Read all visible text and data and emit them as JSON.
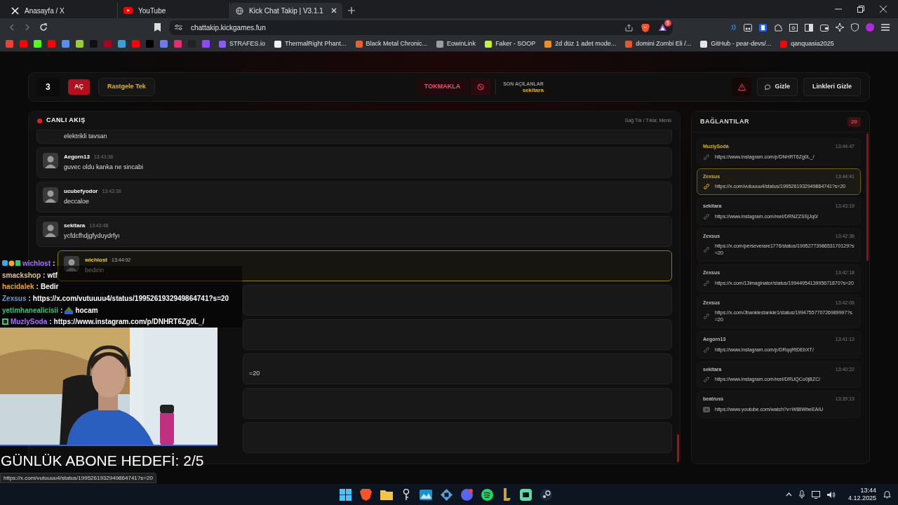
{
  "browser": {
    "tabs": [
      {
        "title": "Anasayfa / X",
        "kind": "x",
        "selected": false
      },
      {
        "title": "YouTube",
        "kind": "youtube",
        "selected": false
      },
      {
        "title": "Kick Chat Takip | V3.1.1",
        "kind": "globe",
        "selected": true
      }
    ],
    "url": "chattakip.kickgames.fun",
    "alert_badge": "5",
    "icon_bookmarks": [
      {
        "color": "#ea4335"
      },
      {
        "color": "#ff0000"
      },
      {
        "color": "#53fc18"
      },
      {
        "color": "#ff0000"
      },
      {
        "color": "#5b8def"
      },
      {
        "color": "#9acd32"
      },
      {
        "color": "#111111"
      },
      {
        "color": "#b00020"
      },
      {
        "color": "#3aa0d8"
      },
      {
        "color": "#ff0000"
      },
      {
        "color": "#000000"
      },
      {
        "color": "#6c7bf0"
      },
      {
        "color": "#e1306c"
      },
      {
        "color": "#222222"
      },
      {
        "color": "#9146ff"
      }
    ],
    "bookmarks": [
      {
        "label": "STRAFES.io",
        "color": "#8b5cf6"
      },
      {
        "label": "ThermalRight Phant...",
        "color": "#f3f3f3"
      },
      {
        "label": "Black Metal Chronic...",
        "color": "#e8622c"
      },
      {
        "label": "EowinLink",
        "color": "#9aa0a6"
      },
      {
        "label": "Faker - SOOP",
        "color": "#c7f23a"
      },
      {
        "label": "2d düz 1 adet mode...",
        "color": "#f28c28"
      },
      {
        "label": "domini Zombi Eli /...",
        "color": "#e05a2b"
      },
      {
        "label": "GitHub - pear-devs/...",
        "color": "#e6e6e6"
      },
      {
        "label": "qanquasia2025",
        "color": "#ff0000"
      }
    ],
    "status_url": "https://x.com/vutuuuu4/status/1995261932949864741?s=20"
  },
  "app": {
    "header": {
      "count": "3",
      "open_button": "AÇ",
      "random_button": "Rastgele Tek",
      "knock_button": "TOKMAKLA",
      "recent_label": "SON AÇILANLAR",
      "recent_user": "sekitara",
      "hide_button": "Gizle",
      "hide_links_button": "Linkleri Gizle"
    },
    "feed": {
      "title": "CANLI AKIŞ",
      "hint": "Sağ Tık / Tıkla: Menü",
      "messages": [
        {
          "kind": "partial",
          "text": "elektrikli tavsan",
          "selected": false
        },
        {
          "kind": "message",
          "user": "Aegorn13",
          "time": "13:43:38",
          "text": "guvec oldu kanka ne sincabi",
          "selected": false
        },
        {
          "kind": "message",
          "user": "ucubefyodor",
          "time": "13:43:39",
          "text": "deccaloe",
          "selected": false
        },
        {
          "kind": "message",
          "user": "sekitara",
          "time": "13:43:48",
          "text": "ycfdcfhdjgfyduydrfyı",
          "selected": false
        },
        {
          "kind": "message",
          "user": "wichlost",
          "time": "13:44:02",
          "text": "bedirin",
          "selected": true
        },
        {
          "kind": "covered",
          "selected": false
        },
        {
          "kind": "covered",
          "selected": false
        },
        {
          "kind": "covered",
          "tail": "=20",
          "selected": false
        },
        {
          "kind": "covered",
          "selected": false
        },
        {
          "kind": "covered",
          "selected": false
        }
      ]
    },
    "links": {
      "title": "BAĞLANTILAR",
      "count": "20",
      "items": [
        {
          "user": "MuzlySoda",
          "time": "13:44:47",
          "url": "https://www.instagram.com/p/DNHRT6Zg0L_/",
          "kind": "link",
          "new": true,
          "selected": false
        },
        {
          "user": "Zexsus",
          "time": "13:44:41",
          "url": "https://x.com/vutuuuu4/status/1995261932949864741?s=20",
          "kind": "link",
          "new": true,
          "selected": true
        },
        {
          "user": "sekitara",
          "time": "13:43:19",
          "url": "https://www.instagram.com/reel/DRNZZSSjJq0/",
          "kind": "link",
          "new": false,
          "selected": false
        },
        {
          "user": "Zexsus",
          "time": "13:42:36",
          "url": "https://x.com/perseverare1776/status/1995277398653170129?s=20",
          "kind": "link",
          "new": false,
          "selected": false
        },
        {
          "user": "Zexsus",
          "time": "13:42:18",
          "url": "https://x.com/13imaginator/status/1994495413995671870?s=20",
          "kind": "link",
          "new": false,
          "selected": false
        },
        {
          "user": "Zexsus",
          "time": "13:42:06",
          "url": "https://x.com/Jbanklestankle1/status/1994755770726989997?s=20",
          "kind": "link",
          "new": false,
          "selected": false
        },
        {
          "user": "Aegorn13",
          "time": "13:41:13",
          "url": "https://www.instagram.com/p/DRqqRtDEbXT/",
          "kind": "link",
          "new": false,
          "selected": false
        },
        {
          "user": "sekitara",
          "time": "13:40:22",
          "url": "https://www.instagram.com/reel/DRUQCo0jBZC/",
          "kind": "link",
          "new": false,
          "selected": false
        },
        {
          "user": "beatruss",
          "time": "13:39:13",
          "url": "https://www.youtube.com/watch?v=W8lIWbeEAIU",
          "kind": "youtube",
          "new": false,
          "selected": false
        }
      ]
    }
  },
  "stream_overlay": {
    "chat": [
      {
        "user": "wichlost",
        "sep": ":",
        "color": "#a970ff",
        "badges": true,
        "emote": false,
        "sub": false
      },
      {
        "user": "smackshop",
        "sep": ":",
        "color": "#e8c08a",
        "text": "wtf",
        "badges": false,
        "emote": false,
        "sub": false
      },
      {
        "user": "hacidalek",
        "sep": ":",
        "color": "#f0a030",
        "text": "Bedir",
        "badges": false,
        "emote": false,
        "sub": false
      },
      {
        "user": "Zexsus",
        "sep": ":",
        "color": "#6a9fd8",
        "text": "https://x.com/vutuuuu4/status/1995261932949864741?s=20",
        "badges": false,
        "emote": false,
        "sub": false
      },
      {
        "user": "yetimhanealicisii",
        "sep": ":",
        "color": "#3ec07a",
        "text": "hocam",
        "badges": false,
        "emote": true,
        "sub": false
      },
      {
        "user": "MuzlySoda",
        "sep": ":",
        "color": "#a970ff",
        "text": "https://www.instagram.com/p/DNHRT6Zg0L_/",
        "badges": false,
        "emote": false,
        "sub": true
      }
    ],
    "goal": "GÜNLÜK ABONE HEDEFİ: 2/5"
  },
  "taskbar": {
    "time": "13:44",
    "date": "4.12.2025"
  }
}
